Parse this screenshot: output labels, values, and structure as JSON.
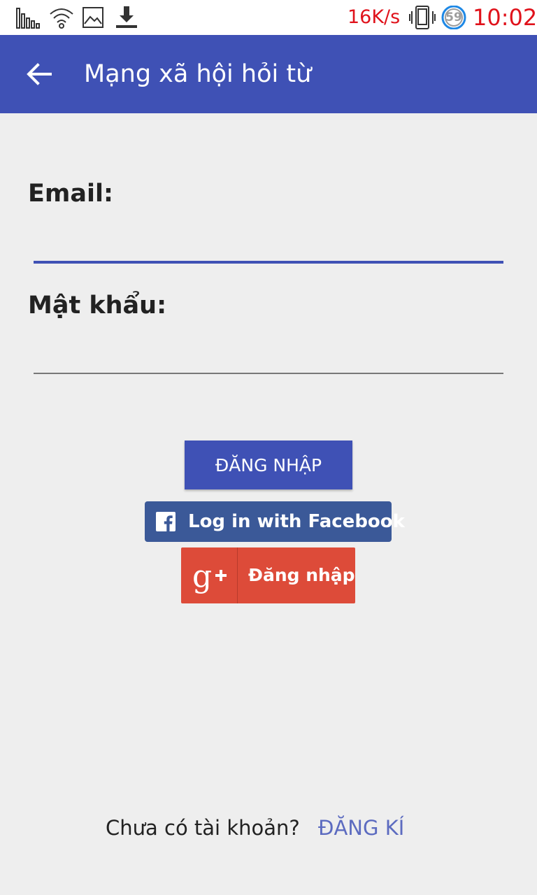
{
  "status_bar": {
    "net_speed": "16K/s",
    "battery_badge": "59",
    "time": "10:02",
    "icons": [
      "signal-bars-icon",
      "wifi-icon",
      "image-icon",
      "download-icon",
      "vibrate-icon",
      "battery-badge-icon"
    ],
    "accent_color": "#e0121b"
  },
  "app_bar": {
    "title": "Mạng xã hội hỏi từ",
    "back_icon": "arrow-left-icon",
    "color": "#3f51b5"
  },
  "form": {
    "email_label": "Email:",
    "email_value": "",
    "password_label": "Mật khẩu:",
    "password_value": ""
  },
  "buttons": {
    "login_label": "ĐĂNG NHẬP",
    "facebook_label": "Log in with Facebook",
    "facebook_icon": "facebook-icon",
    "facebook_color": "#3b5998",
    "google_label": "Đăng nhập",
    "google_icon": "google-plus-icon",
    "google_color": "#dd4b39"
  },
  "footer": {
    "question": "Chưa có tài khoản?",
    "register_link": "ĐĂNG KÍ",
    "link_color": "#5c6bc0"
  }
}
